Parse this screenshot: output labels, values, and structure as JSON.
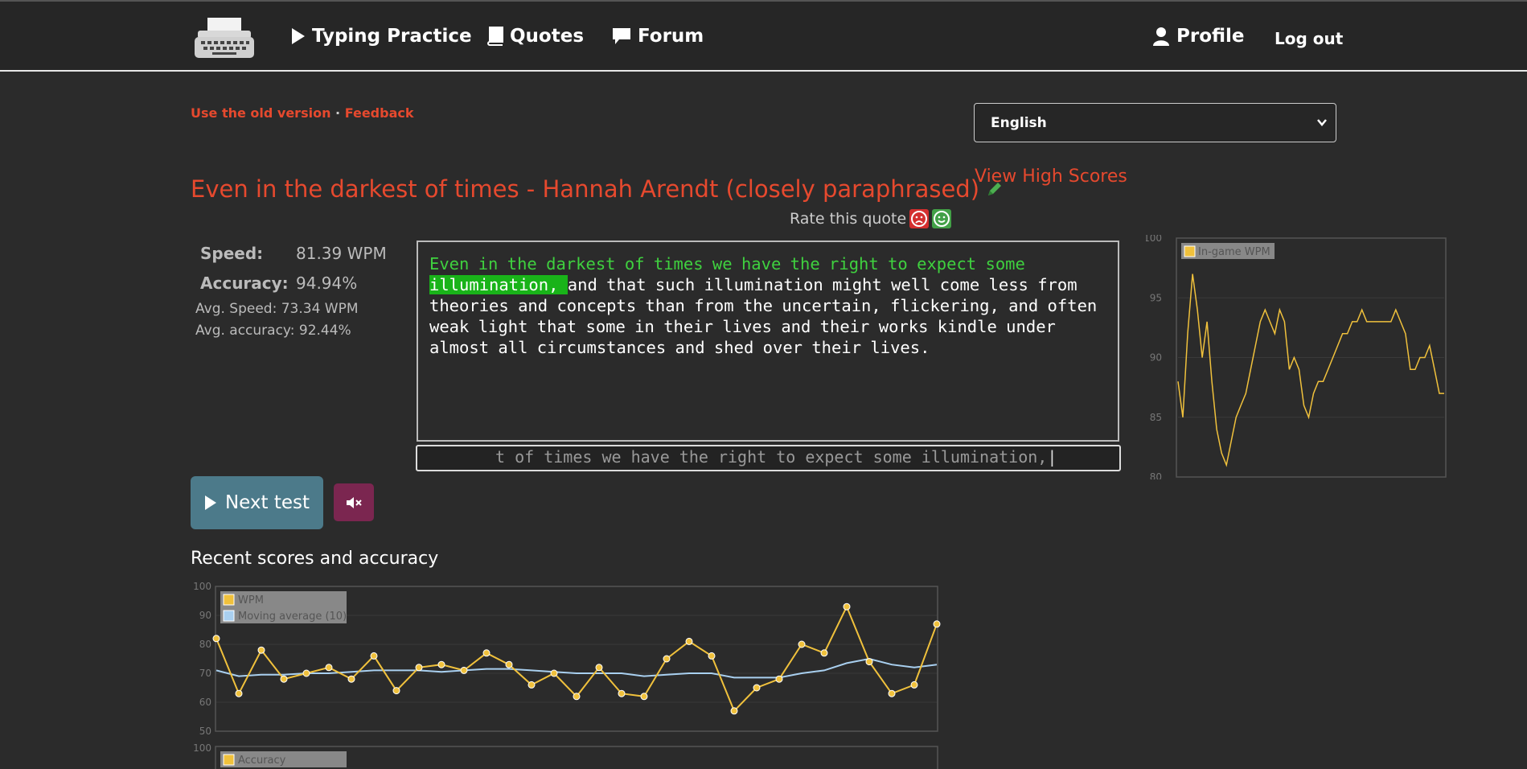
{
  "nav": {
    "typing_practice": "Typing Practice",
    "quotes": "Quotes",
    "forum": "Forum",
    "profile": "Profile",
    "logout": "Log out"
  },
  "links": {
    "old_version": "Use the old version",
    "separator": " · ",
    "feedback": "Feedback"
  },
  "language": {
    "selected": "English"
  },
  "high_scores": "View High Scores",
  "quote": {
    "title": "Even in the darkest of times - Hannah Arendt (closely paraphrased)",
    "rate_label": "Rate this quote",
    "typed_text": "Even in the darkest of times we have the right to expect some ",
    "current_word": "illumination, ",
    "remaining_text": "and that such illumination might well come less from theories and concepts than from the uncertain, flickering, and often weak light that some in their lives and their works kindle under almost all circumstances and shed over their lives."
  },
  "input": {
    "value": "t of times we have the right to expect some illumination,"
  },
  "stats": {
    "speed_label": "Speed:",
    "speed_value": "81.39 WPM",
    "accuracy_label": "Accuracy:",
    "accuracy_value": "94.94%",
    "avg_speed": "Avg. Speed: 73.34 WPM",
    "avg_accuracy": "Avg. accuracy: 92.44%"
  },
  "buttons": {
    "next_test": "Next test"
  },
  "recent_title": "Recent scores and accuracy",
  "colors": {
    "accent": "#e6492e",
    "bg": "#2b2b2b",
    "typed": "#3fd13f",
    "current_bg": "#19b319",
    "next_btn": "#4c7a8a",
    "mute_btn": "#7b2650",
    "wpm_line": "#f0c13c",
    "avg_line": "#a9d0f0"
  },
  "chart_data": [
    {
      "type": "line",
      "name": "ingame",
      "series": [
        {
          "name": "In-game WPM",
          "values": [
            88,
            85,
            92,
            97,
            94,
            90,
            93,
            88,
            84,
            82,
            81,
            83,
            85,
            86,
            87,
            89,
            91,
            93,
            94,
            93,
            92,
            94,
            93,
            89,
            90,
            89,
            86,
            85,
            87,
            88,
            88,
            89,
            90,
            91,
            92,
            92,
            93,
            93,
            94,
            93,
            93,
            93,
            93,
            93,
            93,
            94,
            93,
            92,
            89,
            89,
            90,
            90,
            91,
            89,
            87,
            87
          ]
        }
      ],
      "ylim": [
        80,
        100
      ],
      "yticks": [
        "100",
        "95",
        "90",
        "85",
        "80"
      ]
    },
    {
      "type": "line",
      "name": "recent",
      "series": [
        {
          "name": "WPM",
          "values": [
            82,
            63,
            78,
            68,
            70,
            72,
            68,
            76,
            64,
            72,
            73,
            71,
            77,
            73,
            66,
            70,
            62,
            72,
            63,
            62,
            75,
            81,
            76,
            57,
            65,
            68,
            80,
            77,
            93,
            74,
            63,
            66,
            87
          ]
        },
        {
          "name": "Moving average (10)",
          "values": [
            71,
            69,
            69.5,
            69.5,
            70,
            70,
            70.5,
            71,
            71,
            71,
            70.5,
            71,
            71.5,
            71.5,
            71,
            70.5,
            70,
            70,
            70,
            69,
            69.5,
            70,
            70,
            68.5,
            68.5,
            68.5,
            70,
            71,
            73.5,
            75,
            73,
            72,
            73
          ]
        }
      ],
      "ylim": [
        50,
        100
      ],
      "yticks": [
        "100",
        "90",
        "80",
        "70",
        "60",
        "50"
      ]
    },
    {
      "type": "line",
      "name": "accuracy",
      "series": [
        {
          "name": "Accuracy",
          "values": []
        }
      ],
      "yticks": [
        "100"
      ]
    }
  ]
}
